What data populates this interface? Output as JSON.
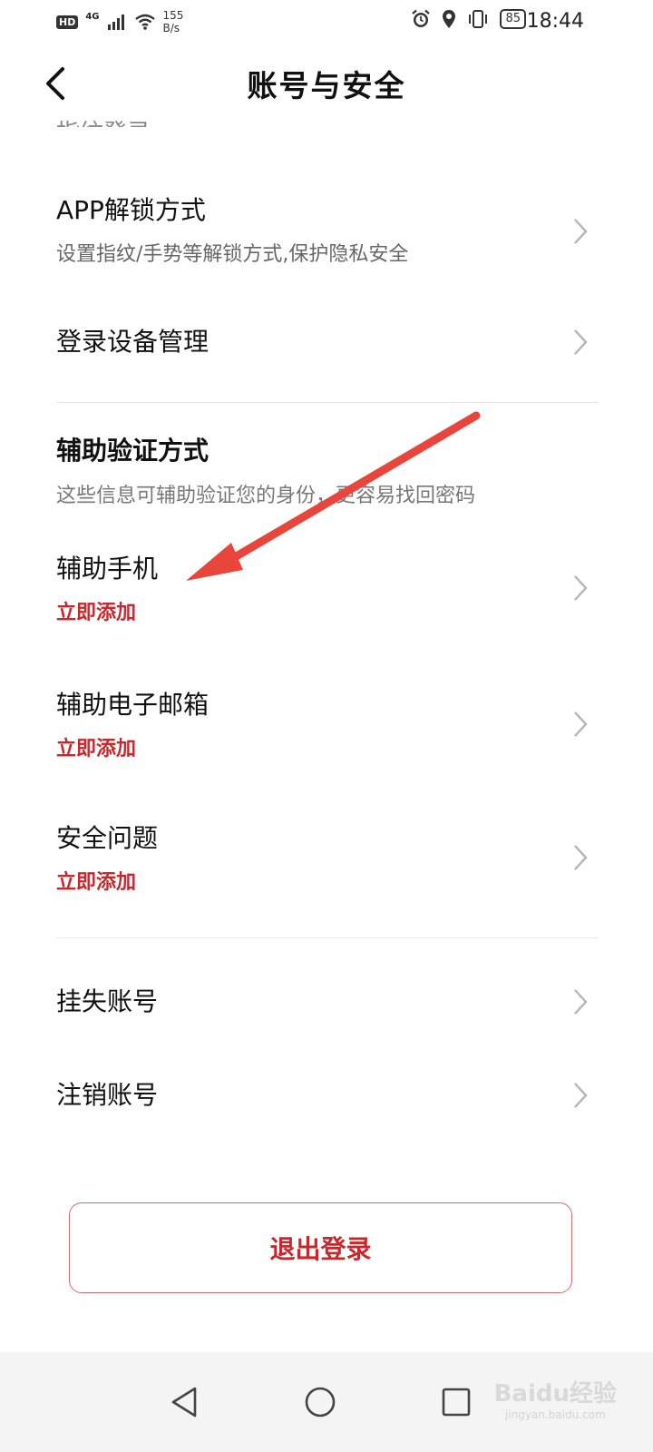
{
  "status_bar": {
    "hd": "HD",
    "network": "4G",
    "speed_value": "155",
    "speed_unit": "B/s",
    "battery": "85",
    "time": "18:44"
  },
  "header": {
    "title": "账号与安全"
  },
  "clipped_row_text": "指纹登录",
  "rows": {
    "app_unlock": {
      "title": "APP解锁方式",
      "subtitle": "设置指纹/手势等解锁方式,保护隐私安全"
    },
    "device_mgmt": {
      "title": "登录设备管理"
    }
  },
  "aux_section": {
    "title": "辅助验证方式",
    "description": "这些信息可辅助验证您的身份，更容易找回密码",
    "items": [
      {
        "title": "辅助手机",
        "action": "立即添加"
      },
      {
        "title": "辅助电子邮箱",
        "action": "立即添加"
      },
      {
        "title": "安全问题",
        "action": "立即添加"
      }
    ]
  },
  "account_rows": {
    "report_lost": "挂失账号",
    "cancel_account": "注销账号"
  },
  "logout_label": "退出登录",
  "watermark": {
    "brand": "Baidu经验",
    "url": "jingyan.baidu.com"
  },
  "colors": {
    "accent_red": "#c8282c",
    "annotation_arrow": "#e8453c"
  },
  "icons": [
    "back-arrow-icon",
    "chevron-right-icon",
    "alarm-icon",
    "location-icon",
    "vibrate-icon",
    "wifi-icon",
    "signal-icon",
    "nav-back-icon",
    "nav-home-icon",
    "nav-recents-icon"
  ]
}
